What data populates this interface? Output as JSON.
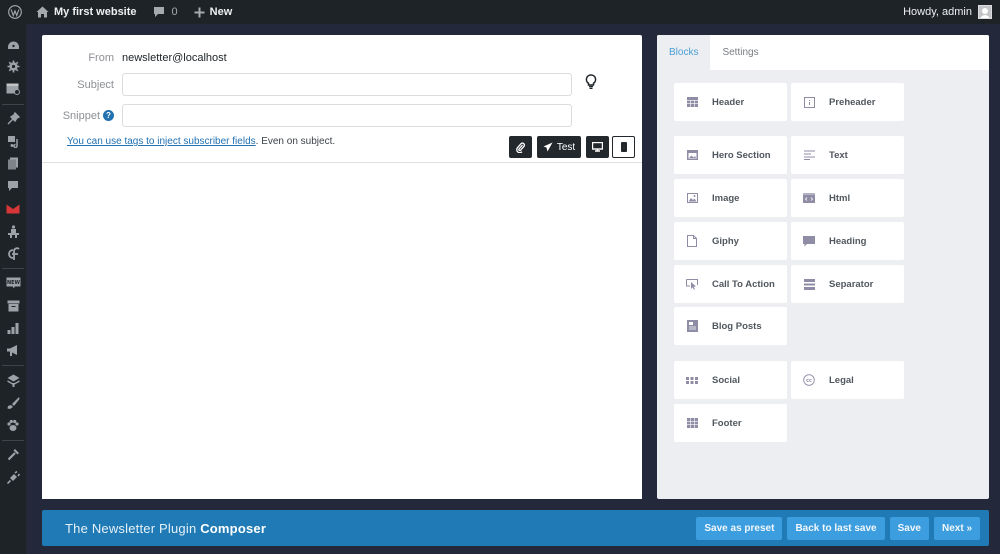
{
  "adminbar": {
    "site_name": "My first website",
    "comments_count": "0",
    "new_label": "New",
    "greeting": "Howdy, admin"
  },
  "admin_menu": {
    "items": [
      {
        "icon": "dashboard-icon"
      },
      {
        "icon": "gear-icon"
      },
      {
        "icon": "browser-check-icon"
      },
      {
        "separator": true
      },
      {
        "icon": "pin-icon"
      },
      {
        "icon": "media-icon"
      },
      {
        "icon": "pages-icon"
      },
      {
        "icon": "comment-icon"
      },
      {
        "icon": "newsletter-mail-icon",
        "color": "#d63638"
      },
      {
        "icon": "plugin-figure-icon"
      },
      {
        "icon": "cf-icon"
      },
      {
        "separator": true
      },
      {
        "icon": "new-badge-icon"
      },
      {
        "icon": "archive-icon"
      },
      {
        "icon": "chart-bars-icon"
      },
      {
        "icon": "megaphone-icon"
      },
      {
        "separator": true
      },
      {
        "icon": "layers-icon"
      },
      {
        "icon": "brush-icon"
      },
      {
        "icon": "paw-icon"
      },
      {
        "separator": true
      },
      {
        "icon": "tools-icon"
      },
      {
        "icon": "plugins-icon"
      }
    ]
  },
  "composer": {
    "from_label": "From",
    "from_value": "newsletter@localhost",
    "subject_label": "Subject",
    "subject_value": "",
    "subject_placeholder": "",
    "snippet_label": "Snippet",
    "snippet_value": "",
    "snippet_placeholder": "",
    "help_glyph": "?",
    "tip_link": "You can use tags to inject subscriber fields",
    "tip_rest": ". Even on subject.",
    "test_label": "Test"
  },
  "sidebar": {
    "tabs": [
      {
        "label": "Blocks",
        "active": true
      },
      {
        "label": "Settings",
        "active": false
      }
    ],
    "blocks": [
      {
        "label": "Header",
        "icon": "header-icon"
      },
      {
        "label": "Preheader",
        "icon": "preheader-icon"
      },
      {
        "label": "Hero Section",
        "icon": "hero-icon"
      },
      {
        "label": "Text",
        "icon": "text-lines-icon"
      },
      {
        "label": "Image",
        "icon": "image-icon"
      },
      {
        "label": "Html",
        "icon": "html-icon"
      },
      {
        "label": "Giphy",
        "icon": "file-icon"
      },
      {
        "label": "Heading",
        "icon": "heading-icon"
      },
      {
        "label": "Call To Action",
        "icon": "cursor-click-icon"
      },
      {
        "label": "Separator",
        "icon": "separator-icon"
      },
      {
        "label": "Blog Posts",
        "icon": "blog-posts-icon"
      },
      {
        "label": "Social",
        "icon": "social-icon"
      },
      {
        "label": "Legal",
        "icon": "cc-icon"
      },
      {
        "label": "Footer",
        "icon": "footer-icon"
      }
    ]
  },
  "footer": {
    "title_prefix": "The Newsletter Plugin ",
    "title_bold": "Composer",
    "buttons": [
      "Save as preset",
      "Back to last save",
      "Save",
      "Next »"
    ]
  },
  "colors": {
    "adminbar_bg": "#1d2327",
    "footer_bg": "#1f7ab5",
    "footer_button_bg": "#3c9ddf",
    "tab_active": "#4a9fd6",
    "link": "#2271b1",
    "block_icon": "#8f8da6"
  }
}
